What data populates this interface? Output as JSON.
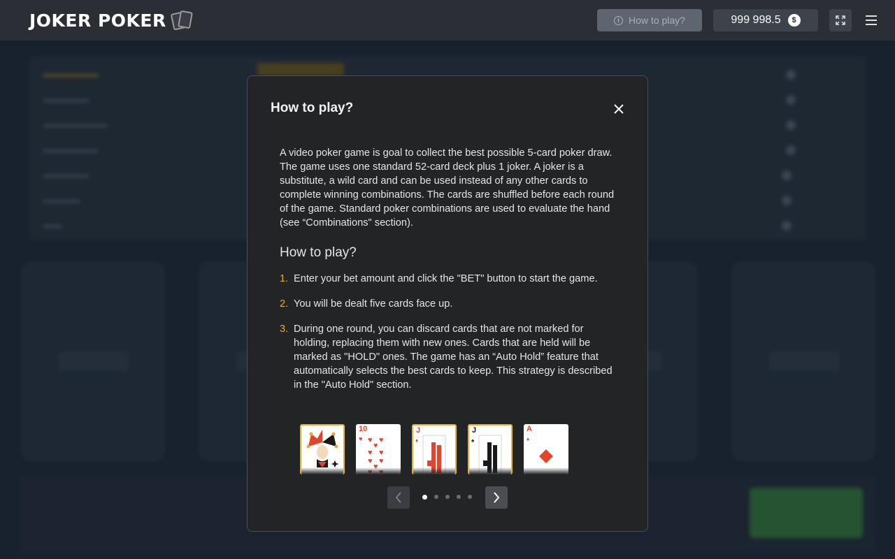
{
  "header": {
    "logo_text": "JOKER POKER",
    "how_to_play_label": "How to play?",
    "balance": "999 998.5",
    "currency_symbol": "$"
  },
  "modal": {
    "title": "How to play?",
    "intro": "A video poker game is goal to collect the best possible 5-card poker draw. The game uses one standard 52-card deck plus 1 joker. A joker is a substitute, a wild card and can be used instead of any other cards to complete winning combinations. The cards are shuffled before each round of the game. Standard poker combinations are used to evaluate the hand (see  “Combinations\" section).",
    "subtitle": "How to play?",
    "steps": [
      {
        "num": "1.",
        "text": "Enter your bet amount and click the \"BET\" button to start the game."
      },
      {
        "num": "2.",
        "text": "You will be dealt five cards face up."
      },
      {
        "num": "3.",
        "text": "During one round, you can discard cards that are not marked for holding, replacing them with new ones. Cards that are held will be marked as \"HOLD\" ones. The game has an “Auto Hold” feature that automatically selects the best cards to keep. This strategy is described in the \"Auto Hold\" section."
      }
    ],
    "cards": [
      {
        "rank": "",
        "suit": "joker",
        "held": true
      },
      {
        "rank": "10",
        "suit": "hearts",
        "held": false
      },
      {
        "rank": "J",
        "suit": "diamonds",
        "held": true
      },
      {
        "rank": "J",
        "suit": "spades",
        "held": true
      },
      {
        "rank": "A",
        "suit": "diamonds",
        "held": false
      }
    ],
    "carousel": {
      "total": 5,
      "active": 0
    }
  },
  "colors": {
    "accent": "#e8a93a",
    "card_red": "#e2452b",
    "modal_bg": "#222425",
    "header_bg": "#2b2f35"
  }
}
